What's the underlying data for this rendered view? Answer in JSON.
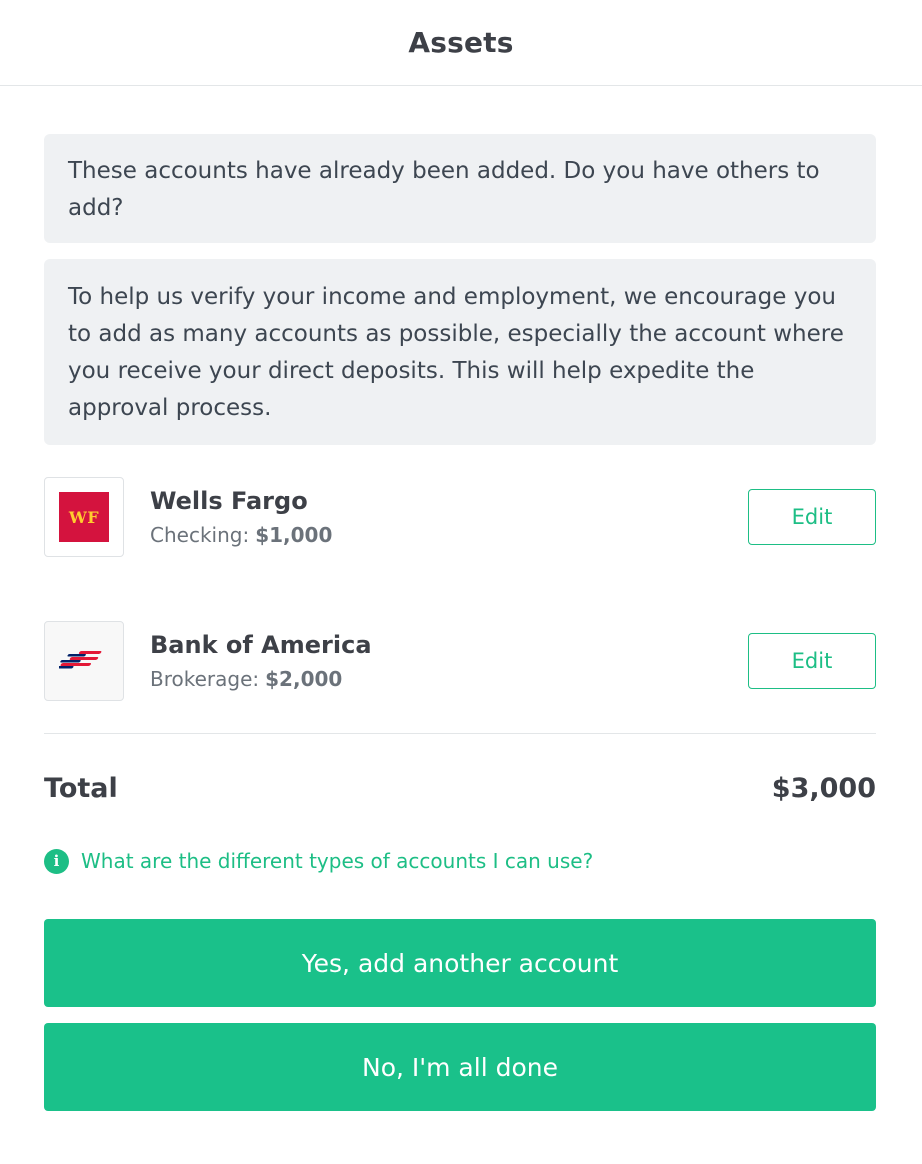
{
  "header": {
    "title": "Assets"
  },
  "notices": [
    {
      "text": "These accounts have already been added. Do you have others to add?"
    },
    {
      "text": "To help us verify your income and employment, we encourage you to add as many accounts as possible, especially the account where you receive your direct deposits. This will help expedite the approval process."
    }
  ],
  "accounts": [
    {
      "logo_icon": "wells-fargo-logo",
      "logo_text": "WF",
      "name": "Wells Fargo",
      "type_label": "Checking:",
      "amount": "$1,000",
      "edit_label": "Edit"
    },
    {
      "logo_icon": "bank-of-america-logo",
      "name": "Bank of America",
      "type_label": "Brokerage:",
      "amount": "$2,000",
      "edit_label": "Edit"
    }
  ],
  "total": {
    "label": "Total",
    "value": "$3,000"
  },
  "info": {
    "icon": "info-icon",
    "icon_glyph": "i",
    "link_text": "What are the different types of accounts I can use?"
  },
  "actions": {
    "add_another_label": "Yes, add another account",
    "done_label": "No, I'm all done"
  },
  "colors": {
    "accent": "#1ac18a",
    "notice_bg": "#eff1f3",
    "wells_fargo_red": "#d4133e",
    "wells_fargo_gold": "#ffcc2e",
    "boa_red": "#e31837",
    "boa_blue": "#012169"
  }
}
